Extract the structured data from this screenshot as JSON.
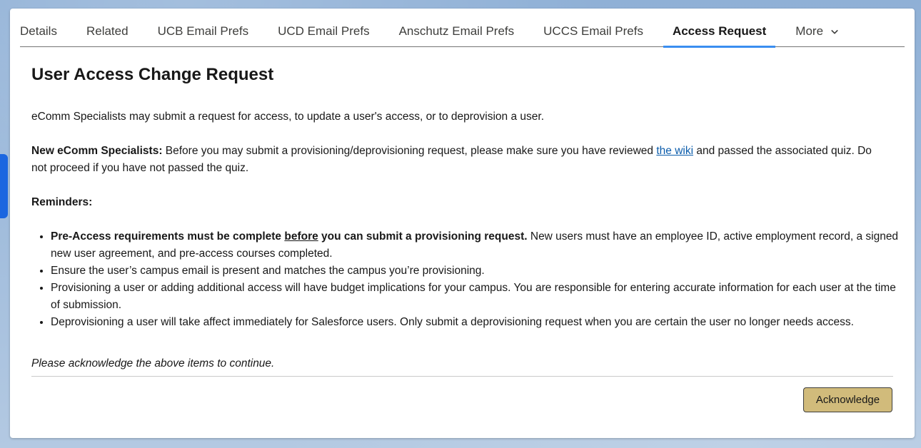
{
  "tabs": [
    {
      "label": "Details"
    },
    {
      "label": "Related"
    },
    {
      "label": "UCB Email Prefs"
    },
    {
      "label": "UCD Email Prefs"
    },
    {
      "label": "Anschutz Email Prefs"
    },
    {
      "label": "UCCS Email Prefs"
    },
    {
      "label": "Access Request",
      "active": true
    },
    {
      "label": "More",
      "icon": "chevron-down-icon"
    }
  ],
  "page": {
    "title": "User Access Change Request",
    "intro": "eComm Specialists may submit a request for access, to update a user's access, or to deprovision a user.",
    "new_specialists": {
      "label": "New eComm Specialists:",
      "text_before_link": " Before you may submit a provisioning/deprovisioning request, please make sure you have reviewed ",
      "link_text": "the wiki",
      "text_after_link": " and passed the associated quiz. Do not proceed if you have not passed the quiz."
    },
    "reminders_label": "Reminders:",
    "reminders": {
      "item1_bold_a": "Pre-Access requirements must be complete ",
      "item1_bold_underline": "before",
      "item1_bold_b": " you can submit a provisioning request.",
      "item1_rest": " New users must have an employee ID, active employment record, a signed new user agreement, and pre-access courses completed.",
      "item2": "Ensure the user’s campus email is present and matches the campus you’re provisioning.",
      "item3": "Provisioning a user or adding additional access will have budget implications for your campus. You are responsible for entering accurate information for each user at the time of submission.",
      "item4": "Deprovisioning a user will take affect immediately for Salesforce users. Only submit a deprovisioning request when you are certain the user no longer needs access."
    },
    "acknowledge_prompt": "Please acknowledge the above items to continue.",
    "acknowledge_button": "Acknowledge"
  },
  "colors": {
    "active_tab_underline": "#3a8ef0",
    "button_bg": "#d1bb7b",
    "link": "#0b5cab"
  }
}
